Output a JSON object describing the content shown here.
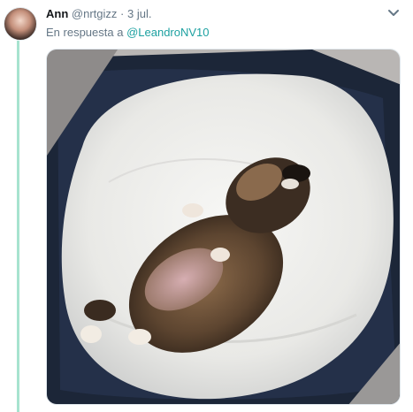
{
  "tweet": {
    "author_name": "Ann",
    "author_handle": "@nrtgizz",
    "separator": "·",
    "timestamp": "3 jul.",
    "reply_prefix": "En respuesta a",
    "reply_mention": "@LeandroNV10"
  },
  "media": {
    "description_icon": "photo-of-puppy-sleeping-on-back"
  },
  "colors": {
    "thread_line": "#a7e3cf",
    "mention": "#1da1a1",
    "secondary_text": "#657786"
  }
}
